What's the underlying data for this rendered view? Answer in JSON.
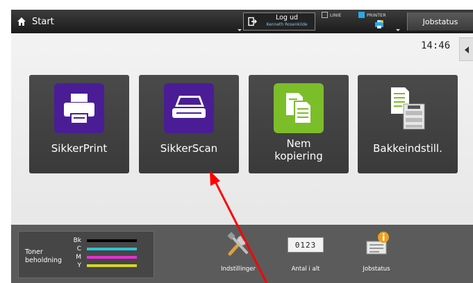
{
  "topbar": {
    "home_label": "Start",
    "logout_label": "Log ud",
    "logout_user": "Kenneth Rosenkilde",
    "line_status": "LINIE",
    "printer_status": "PRINTER",
    "jobstatus_label": "Jobstatus"
  },
  "clock": "14:46",
  "tiles": [
    {
      "label": "SikkerPrint",
      "icon": "printer-icon"
    },
    {
      "label": "SikkerScan",
      "icon": "scanner-icon"
    },
    {
      "label": "Nem\nkopiering",
      "icon": "copy-icon"
    },
    {
      "label": "Bakkeindstill.",
      "icon": "tray-settings-icon"
    }
  ],
  "toner": {
    "label": "Toner\nbeholdning",
    "colors": [
      {
        "name": "Bk",
        "hex": "#000000"
      },
      {
        "name": "C",
        "hex": "#2ec3d4"
      },
      {
        "name": "M",
        "hex": "#e62fd6"
      },
      {
        "name": "Y",
        "hex": "#d6d628"
      }
    ]
  },
  "bottom": {
    "settings_label": "Indstillinger",
    "counter_label": "Antal i alt",
    "counter_value": "0123",
    "jobstatus_label": "Jobstatus"
  },
  "colors": {
    "accent_blue": "#29a9e6",
    "tile_purple": "#4a1d96",
    "tile_green": "#7cbd2a",
    "annotation_red": "#ff0000"
  }
}
